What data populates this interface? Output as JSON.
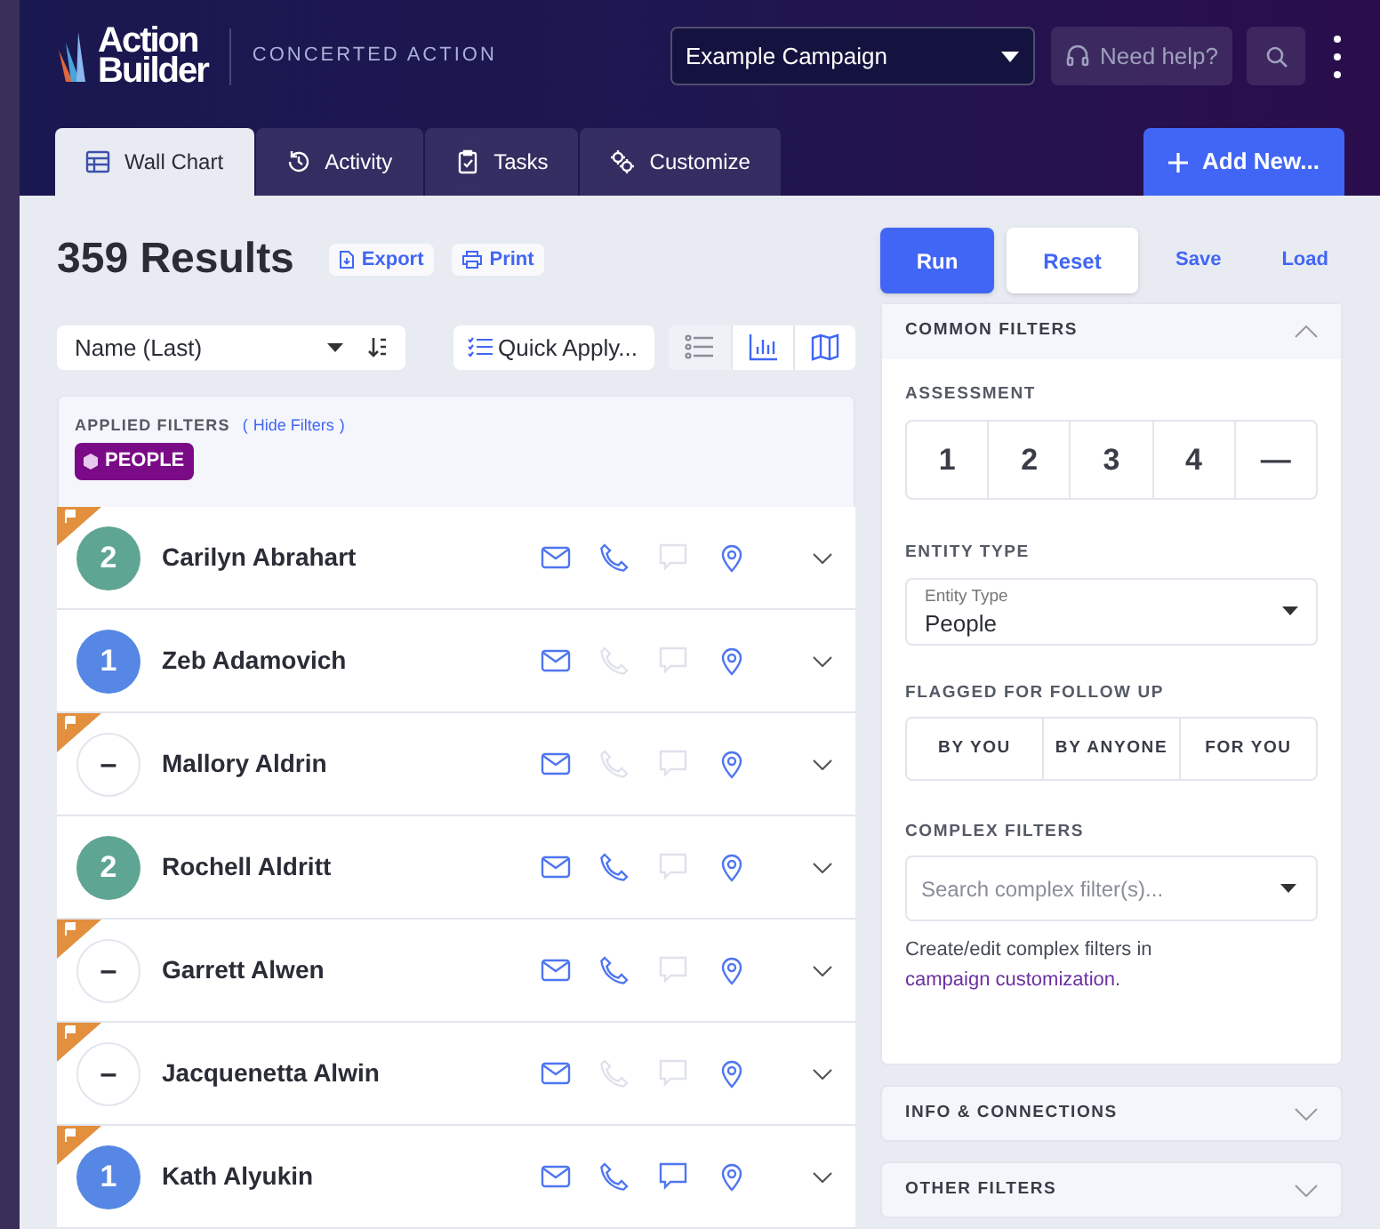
{
  "header": {
    "logo_line1": "Action",
    "logo_line2": "Builder",
    "org": "CONCERTED ACTION",
    "campaign": "Example Campaign",
    "help": "Need help?"
  },
  "tabs": [
    {
      "label": "Wall Chart",
      "kind": "table",
      "selected": true
    },
    {
      "label": "Activity",
      "kind": "history",
      "selected": false
    },
    {
      "label": "Tasks",
      "kind": "tasks",
      "selected": false
    },
    {
      "label": "Customize",
      "kind": "settings",
      "selected": false
    }
  ],
  "add_button": "Add New...",
  "results": {
    "title": "359 Results",
    "export": "Export",
    "print": "Print"
  },
  "sort": {
    "value": "Name (Last)"
  },
  "quick_apply": "Quick Apply...",
  "views": [
    {
      "kind": "list",
      "selected": true
    },
    {
      "kind": "chart",
      "selected": false
    },
    {
      "kind": "map",
      "selected": false
    }
  ],
  "applied_filters": {
    "label": "APPLIED FILTERS",
    "open": "(",
    "link": "Hide Filters",
    "close": ")",
    "chip": "PEOPLE"
  },
  "people": [
    {
      "name": "Carilyn Abrahart",
      "assessment": "2",
      "color": "#5fa594",
      "flagged": true,
      "email": true,
      "phone": true,
      "text": false,
      "location": true
    },
    {
      "name": "Zeb Adamovich",
      "assessment": "1",
      "color": "#5687e4",
      "flagged": false,
      "email": true,
      "phone": false,
      "text": false,
      "location": true
    },
    {
      "name": "Mallory Aldrin",
      "assessment": "–",
      "color": "#ffffff",
      "flagged": true,
      "email": true,
      "phone": false,
      "text": false,
      "location": true
    },
    {
      "name": "Rochell Aldritt",
      "assessment": "2",
      "color": "#5fa594",
      "flagged": false,
      "email": true,
      "phone": true,
      "text": false,
      "location": true
    },
    {
      "name": "Garrett Alwen",
      "assessment": "–",
      "color": "#ffffff",
      "flagged": true,
      "email": true,
      "phone": true,
      "text": false,
      "location": true
    },
    {
      "name": "Jacquenetta Alwin",
      "assessment": "–",
      "color": "#ffffff",
      "flagged": true,
      "email": true,
      "phone": false,
      "text": false,
      "location": true
    },
    {
      "name": "Kath Alyukin",
      "assessment": "1",
      "color": "#5687e4",
      "flagged": true,
      "email": true,
      "phone": true,
      "text": true,
      "location": true
    }
  ],
  "actions": {
    "run": "Run",
    "reset": "Reset",
    "save": "Save",
    "load": "Load"
  },
  "common_filters": {
    "title": "COMMON FILTERS",
    "expanded": true,
    "assessment_label": "ASSESSMENT",
    "assessment_options": [
      "1",
      "2",
      "3",
      "4",
      "—"
    ],
    "entity_label": "ENTITY TYPE",
    "entity_field_label": "Entity Type",
    "entity_value": "People",
    "flagged_label": "FLAGGED FOR FOLLOW UP",
    "flagged_options": [
      "BY YOU",
      "BY ANYONE",
      "FOR YOU"
    ],
    "complex_label": "COMPLEX FILTERS",
    "complex_placeholder": "Search complex filter(s)...",
    "help_text": "Create/edit complex filters in",
    "help_link": "campaign customization",
    "help_end": "."
  },
  "sections": [
    {
      "title": "INFO & CONNECTIONS",
      "expanded": false
    },
    {
      "title": "OTHER FILTERS",
      "expanded": false
    }
  ]
}
